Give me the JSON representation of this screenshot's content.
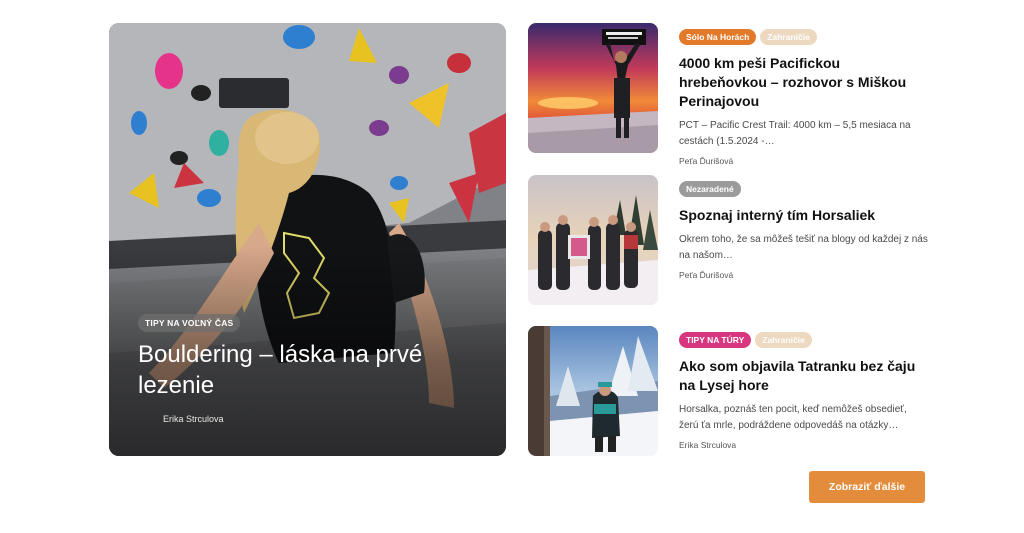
{
  "featured": {
    "tag": "TIPY NA VOĽNÝ ČAS",
    "title": "Bouldering – láska na prvé lezenie",
    "author": "Erika Strculova"
  },
  "posts": [
    {
      "chips": [
        {
          "label": "Sólo Na Horách",
          "color": "#e27a2a"
        },
        {
          "label": "Zahraničie",
          "color": "#ecd9bf"
        }
      ],
      "title": "4000 km peši Pacifickou hrebeňovkou – rozhovor s Miškou Perinajovou",
      "excerpt": "PCT – Pacific Crest Trail: 4000 km – 5,5 mesiaca na cestách (1.5.2024 -…",
      "author": "Peťa Ďurišová"
    },
    {
      "chips": [
        {
          "label": "Nezaradené",
          "color": "#9b9b9b"
        }
      ],
      "title": "Spoznaj interný tím Horsaliek",
      "excerpt": "Okrem toho, že sa môžeš tešiť na blogy od každej z nás na našom…",
      "author": "Peťa Ďurišová"
    },
    {
      "chips": [
        {
          "label": "TIPY NA TÚRY",
          "color": "#d6377f"
        },
        {
          "label": "Zahraničie",
          "color": "#ecd9bf"
        }
      ],
      "title": "Ako som objavila Tatranku bez čaju na Lysej hore",
      "excerpt": "Horsalka, poznáš ten pocit, keď nemôžeš obsedieť, žerú ťa mrle, podráždene odpovedáš na otázky…",
      "author": "Erika Strculova"
    }
  ],
  "load_more": "Zobraziť ďalšie"
}
